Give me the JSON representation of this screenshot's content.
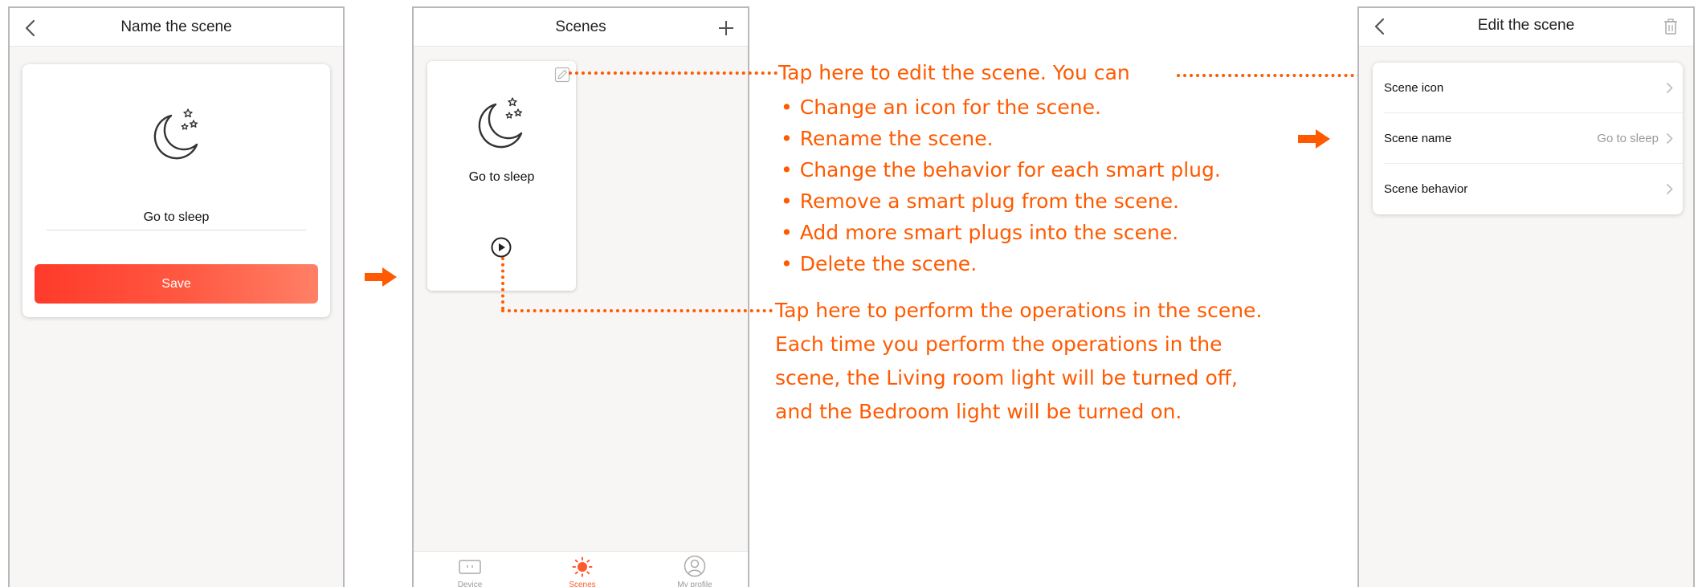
{
  "colors": {
    "accent": "#ff5a00",
    "save_gradient_start": "#ff3a2a",
    "save_gradient_end": "#ff8066",
    "tab_active": "#ff5a2c"
  },
  "screen1": {
    "title": "Name the scene",
    "back_icon": "chevron-left-icon",
    "scene_icon": "moon-stars-icon",
    "name_value": "Go to sleep",
    "save_label": "Save"
  },
  "screen2": {
    "title": "Scenes",
    "add_icon": "plus-icon",
    "card": {
      "name": "Go to sleep",
      "icon": "moon-stars-icon",
      "edit_icon": "pencil-edit-icon",
      "play_icon": "play-circle-icon"
    },
    "tabs": [
      {
        "label": "Device",
        "icon": "socket-icon",
        "active": false
      },
      {
        "label": "Scenes",
        "icon": "sun-icon",
        "active": true
      },
      {
        "label": "My profile",
        "icon": "person-icon",
        "active": false
      }
    ]
  },
  "screen3": {
    "title": "Edit the scene",
    "back_icon": "chevron-left-icon",
    "delete_icon": "trash-icon",
    "rows": [
      {
        "label": "Scene icon",
        "value": ""
      },
      {
        "label": "Scene name",
        "value": "Go to sleep"
      },
      {
        "label": "Scene behavior",
        "value": ""
      }
    ]
  },
  "annotations": {
    "edit_intro": "Tap here to edit the scene. You can",
    "edit_items": [
      "Change an icon for the scene.",
      "Rename the scene.",
      "Change the behavior for each smart plug.",
      "Remove a smart plug from the scene.",
      "Add more smart plugs into the scene.",
      "Delete the scene."
    ],
    "perform_lines": [
      "Tap here to perform the operations in the scene.",
      "Each time you perform the operations in the",
      "scene, the Living room light will be turned off,",
      "and the Bedroom light will be turned on."
    ]
  }
}
